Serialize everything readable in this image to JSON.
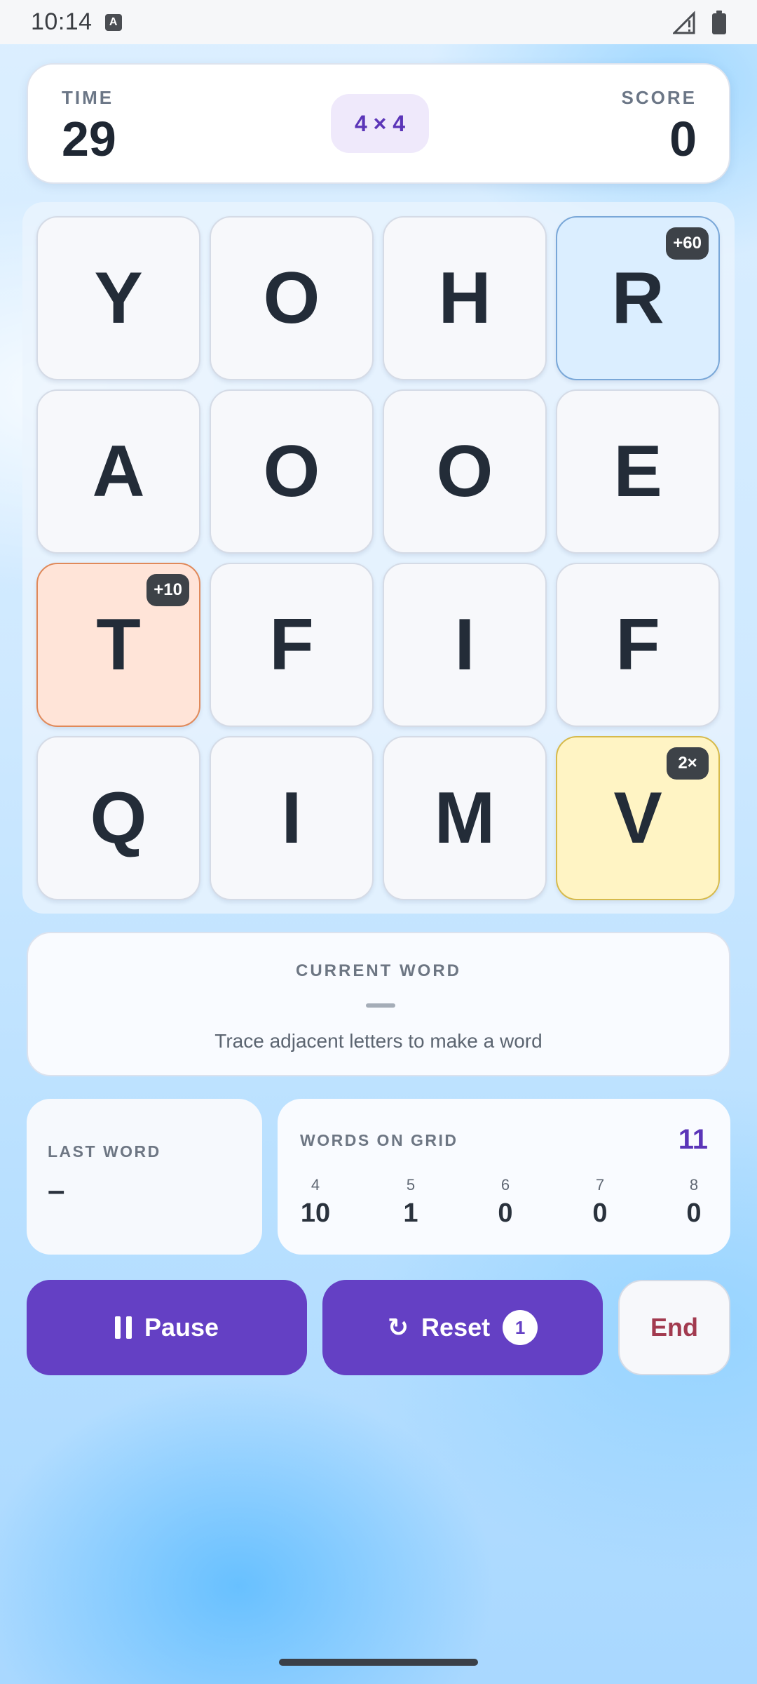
{
  "status_bar": {
    "time": "10:14",
    "a_label": "A"
  },
  "stats": {
    "time_label": "TIME",
    "time_value": "29",
    "size_label": "4 × 4",
    "score_label": "SCORE",
    "score_value": "0"
  },
  "grid": {
    "tiles": [
      {
        "letter": "Y",
        "badge": ""
      },
      {
        "letter": "O",
        "badge": ""
      },
      {
        "letter": "H",
        "badge": ""
      },
      {
        "letter": "R",
        "badge": "+60"
      },
      {
        "letter": "A",
        "badge": ""
      },
      {
        "letter": "O",
        "badge": ""
      },
      {
        "letter": "O",
        "badge": ""
      },
      {
        "letter": "E",
        "badge": ""
      },
      {
        "letter": "T",
        "badge": "+10"
      },
      {
        "letter": "F",
        "badge": ""
      },
      {
        "letter": "I",
        "badge": ""
      },
      {
        "letter": "F",
        "badge": ""
      },
      {
        "letter": "Q",
        "badge": ""
      },
      {
        "letter": "I",
        "badge": ""
      },
      {
        "letter": "M",
        "badge": ""
      },
      {
        "letter": "V",
        "badge": "2×"
      }
    ]
  },
  "current_word": {
    "label": "CURRENT WORD",
    "hint": "Trace adjacent letters to make a word"
  },
  "last_word": {
    "label": "LAST WORD",
    "value": "–"
  },
  "words_on_grid": {
    "label": "WORDS ON GRID",
    "total": "11",
    "lengths": [
      {
        "len": "4",
        "count": "10"
      },
      {
        "len": "5",
        "count": "1"
      },
      {
        "len": "6",
        "count": "0"
      },
      {
        "len": "7",
        "count": "0"
      },
      {
        "len": "8",
        "count": "0"
      }
    ]
  },
  "buttons": {
    "pause_label": "Pause",
    "reset_label": "Reset",
    "reset_count": "1",
    "end_label": "End"
  },
  "colors": {
    "accent": "#6440c4",
    "tile_blue": "#dbeeff",
    "tile_orange": "#ffe4d8",
    "tile_yellow": "#fff4c4",
    "end_text": "#a23a4f"
  }
}
